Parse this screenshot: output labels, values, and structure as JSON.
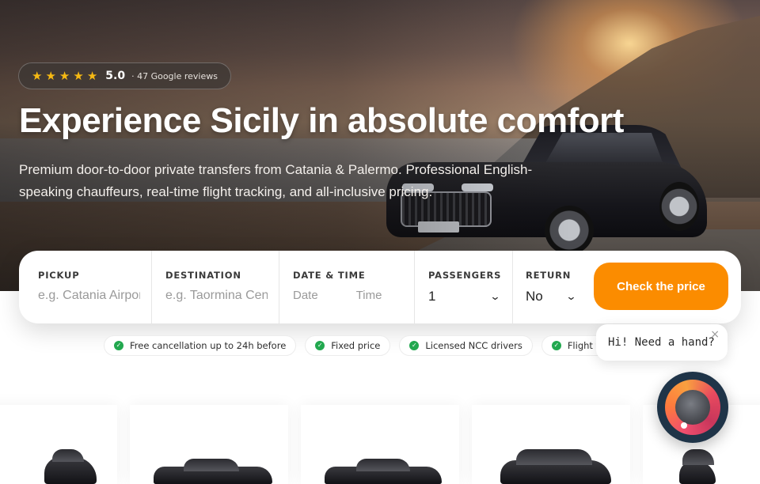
{
  "hero": {
    "rating": {
      "stars": 5,
      "score": "5.0",
      "reviews": "· 47 Google reviews"
    },
    "title": "Experience Sicily in absolute comfort",
    "subtitle": "Premium door-to-door private transfers from Catania & Palermo. Professional English-speaking chauffeurs, real-time flight tracking, and all-inclusive pricing."
  },
  "booking": {
    "pickup": {
      "label": "PICKUP",
      "placeholder": "e.g. Catania Airport"
    },
    "destination": {
      "label": "DESTINATION",
      "placeholder": "e.g. Taormina Center"
    },
    "datetime": {
      "label": "DATE & TIME",
      "date_placeholder": "Date",
      "time_placeholder": "Time"
    },
    "passengers": {
      "label": "PASSENGERS",
      "value": "1"
    },
    "return": {
      "label": "RETURN",
      "value": "No"
    },
    "cta": "Check the price"
  },
  "features": [
    "Free cancellation up to 24h before",
    "Fixed price",
    "Licensed NCC drivers",
    "Flight tra"
  ],
  "chat": {
    "bubble": "Hi! Need a hand?",
    "close": "×"
  },
  "colors": {
    "accent": "#fb8c00",
    "check": "#22a84f",
    "star": "#f6b913",
    "chat_fab": "#1f3448"
  }
}
